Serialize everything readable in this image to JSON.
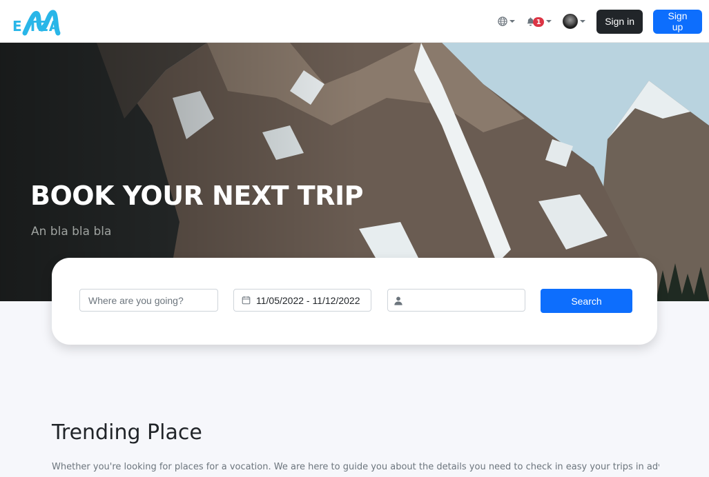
{
  "brand": {
    "logo_text": "E TZA"
  },
  "header": {
    "signin_label": "Sign in",
    "signup_label": "Sign up",
    "notification_count": "1",
    "icons": [
      "globe-icon",
      "bell-icon",
      "avatar"
    ]
  },
  "hero": {
    "title": "BOOK YOUR NEXT TRIP",
    "subtitle": "An bla bla bla"
  },
  "search": {
    "where_placeholder": "Where are you going?",
    "date_range": "11/05/2022 - 11/12/2022",
    "guests_value": "",
    "button_label": "Search"
  },
  "trending": {
    "title": "Trending Place",
    "description": "Whether you're looking for places for a vocation. We are here to guide you about the details you need to check in easy your trips in advanced"
  },
  "colors": {
    "primary": "#0d6efd",
    "dark": "#212529",
    "badge": "#dc3545",
    "logo": "#29b6e8"
  }
}
